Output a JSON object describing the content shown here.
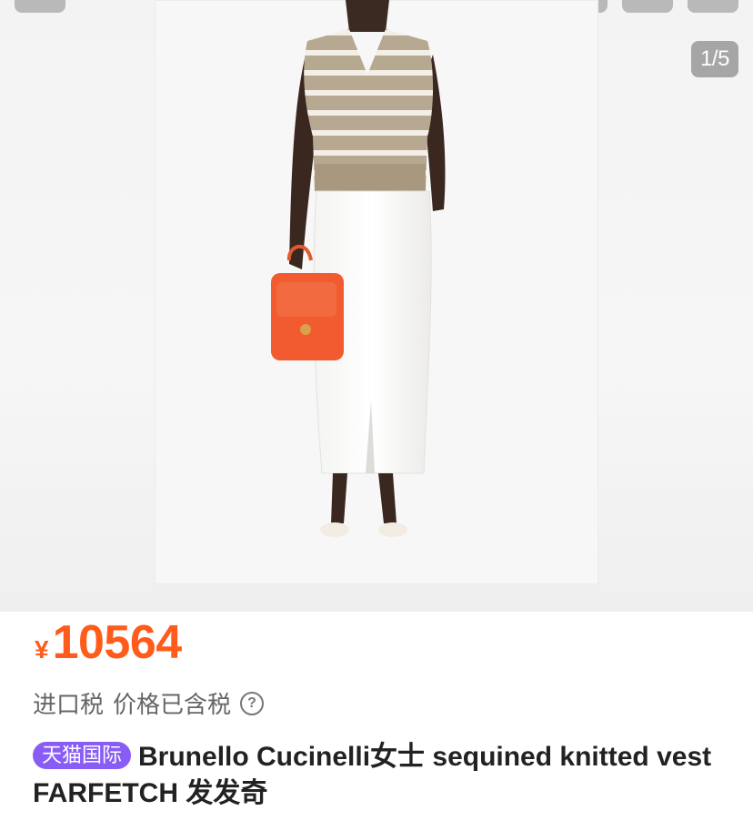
{
  "gallery": {
    "page_indicator": "1/5"
  },
  "price": {
    "currency": "¥",
    "amount": "10564",
    "accent_color": "#ff5b1a"
  },
  "tax": {
    "label": "进口税",
    "note": "价格已含税",
    "help_icon": "question-circle-icon"
  },
  "product": {
    "badge": "天猫国际",
    "badge_color": "#8a5cf6",
    "title": "Brunello Cucinelli女士 sequined knitted vest FARFETCH 发发奇"
  }
}
